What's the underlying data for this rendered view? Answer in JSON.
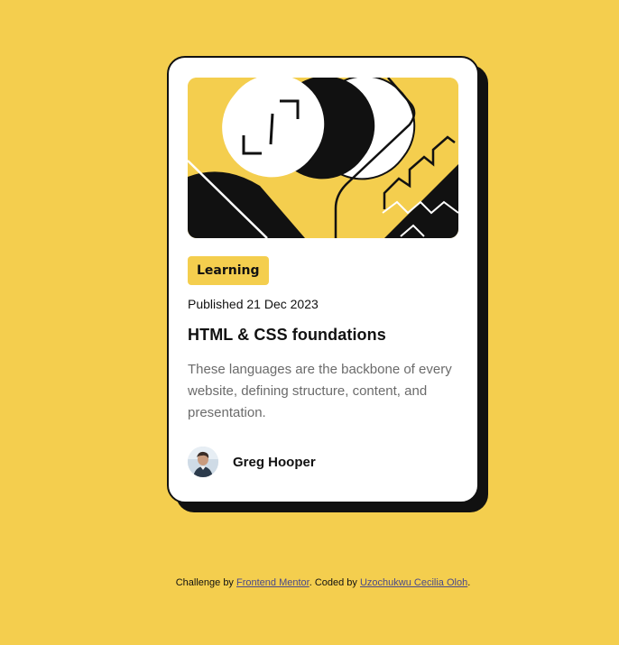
{
  "card": {
    "tag": "Learning",
    "published": "Published 21 Dec 2023",
    "title": "HTML & CSS foundations",
    "description": "These languages are the backbone of every website, defining structure, content, and presentation.",
    "author": "Greg Hooper"
  },
  "attribution": {
    "prefix": "Challenge by ",
    "link1": "Frontend Mentor",
    "middle": ". Coded by ",
    "link2": "Uzochukwu Cecilia Oloh",
    "suffix": "."
  },
  "colors": {
    "background": "#F4CE4E",
    "card": "#FFFFFF",
    "ink": "#111111",
    "muted": "#6B6B6B"
  },
  "icons": [
    "illustration-article",
    "avatar-photo"
  ]
}
